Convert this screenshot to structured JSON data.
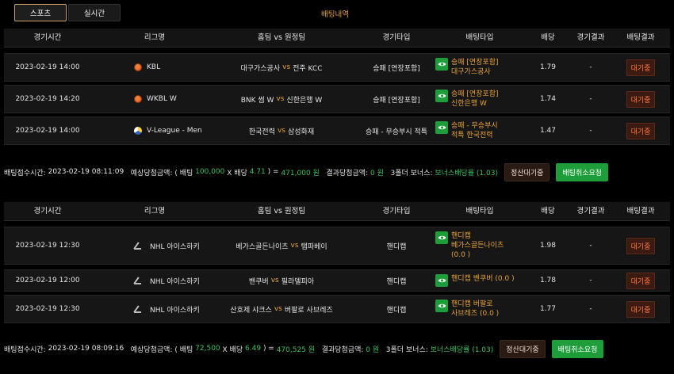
{
  "tabs": {
    "sports": "스포츠",
    "live": "실시간"
  },
  "page_title": "배팅내역",
  "columns": [
    "경기시간",
    "리그명",
    "홈팀 vs 원정팀",
    "경기타입",
    "배팅타입",
    "배당",
    "경기결과",
    "배팅결과"
  ],
  "vs": "vs",
  "slips": [
    {
      "rows": [
        {
          "time": "2023-02-19 14:00",
          "league": "KBL",
          "league_icon": "basketball-icon",
          "home": "대구가스공사",
          "away": "전주 KCC",
          "type": "승패 [연장포함]",
          "bet_line1": "승패 [연장포함]",
          "bet_line2": "대구가스공사",
          "bet_line3": "",
          "odds": "1.79",
          "result": "-",
          "status": "대기중"
        },
        {
          "time": "2023-02-19 14:20",
          "league": "WKBL W",
          "league_icon": "basketball-icon",
          "home": "BNK 썸 W",
          "away": "신한은행 W",
          "type": "승패 [연장포함]",
          "bet_line1": "승패 [연장포함]",
          "bet_line2": "신한은행 W",
          "bet_line3": "",
          "odds": "1.74",
          "result": "-",
          "status": "대기중"
        },
        {
          "time": "2023-02-19 14:00",
          "league": "V-League - Men",
          "league_icon": "volleyball-icon",
          "home": "한국전력",
          "away": "삼성화재",
          "type": "승패 - 무승부시 적특",
          "bet_line1": "승패 - 무승부시",
          "bet_line2": "적특 한국전력",
          "bet_line3": "",
          "odds": "1.47",
          "result": "-",
          "status": "대기중"
        }
      ],
      "summary": {
        "accept_label": "배팅접수시간:",
        "accept_time": "2023-02-19 08:11:09",
        "expected_label": "예상당첨금액: ( 배팅",
        "bet_amount": "100,000",
        "x_label": "X 배당",
        "total_odds": "4.71",
        "eq_label": ") =",
        "expected_amount": "471,000 원",
        "won_label": "결과당첨금액:",
        "won_amount": "0 원",
        "bonus_label": "3폴더 보너스:",
        "bonus_value": "보너스배당률 (1.03)",
        "settle_label": "정산대기중",
        "cancel_label": "배팅취소요청"
      }
    },
    {
      "rows": [
        {
          "time": "2023-02-19 12:30",
          "league": "NHL 아이스하키",
          "league_icon": "hockey-icon",
          "home": "베가스골든나이츠",
          "away": "탬파베이",
          "type": "핸디캡",
          "bet_line1": "핸디캡",
          "bet_line2": "베가스골든나이츠",
          "bet_line3": "(0.0 )",
          "odds": "1.98",
          "result": "-",
          "status": "대기중"
        },
        {
          "time": "2023-02-19 12:00",
          "league": "NHL 아이스하키",
          "league_icon": "hockey-icon",
          "home": "밴쿠버",
          "away": "필라델피아",
          "type": "핸디캡",
          "bet_line1": "핸디캡 밴쿠버 (0.0 )",
          "bet_line2": "",
          "bet_line3": "",
          "odds": "1.78",
          "result": "-",
          "status": "대기중"
        },
        {
          "time": "2023-02-19 12:30",
          "league": "NHL 아이스하키",
          "league_icon": "hockey-icon",
          "home": "산호제 샤크스",
          "away": "버팔로 사브레즈",
          "type": "핸디캡",
          "bet_line1": "핸디캡 버팔로",
          "bet_line2": "사브레즈 (0.0 )",
          "bet_line3": "",
          "odds": "1.77",
          "result": "-",
          "status": "대기중"
        }
      ],
      "summary": {
        "accept_label": "배팅접수시간:",
        "accept_time": "2023-02-19 08:09:16",
        "expected_label": "예상당첨금액: ( 배팅",
        "bet_amount": "72,500",
        "x_label": "X 배당",
        "total_odds": "6.49",
        "eq_label": ") =",
        "expected_amount": "470,525 원",
        "won_label": "결과당첨금액:",
        "won_amount": "0 원",
        "bonus_label": "3폴더 보너스:",
        "bonus_value": "보너스배당률 (1.03)",
        "settle_label": "정산대기중",
        "cancel_label": "배팅취소요청"
      }
    }
  ]
}
